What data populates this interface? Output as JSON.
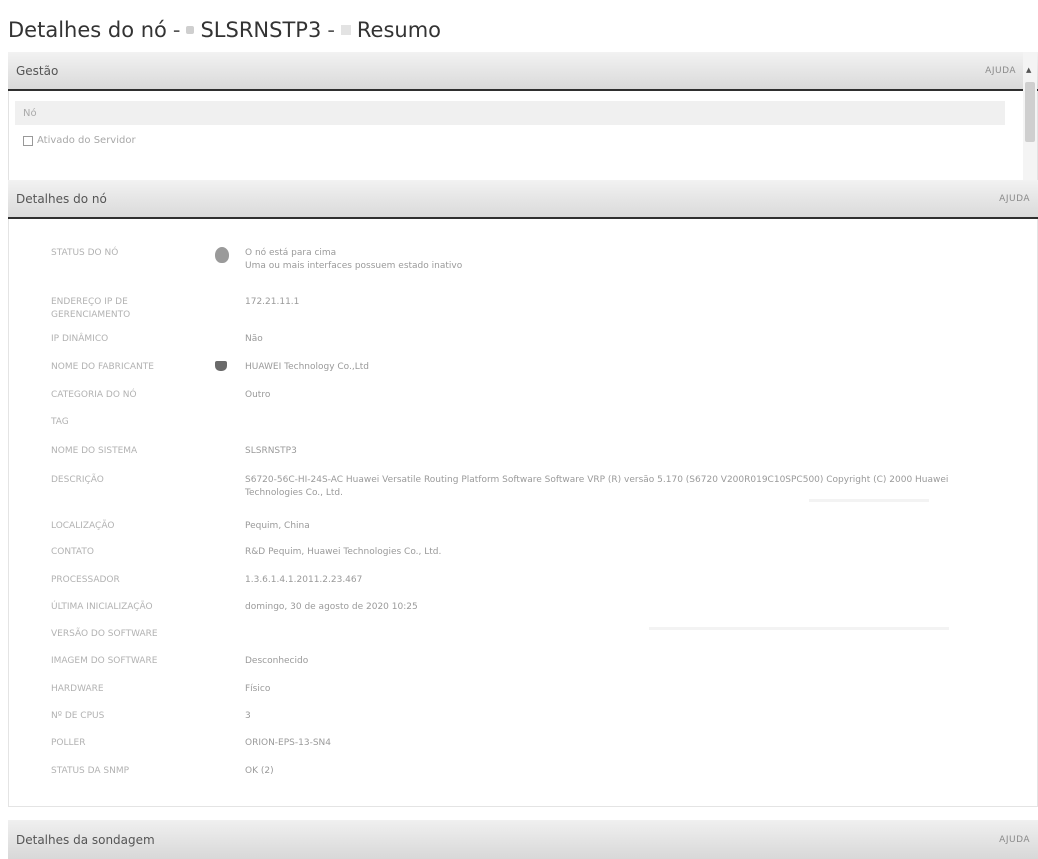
{
  "title": {
    "part1": "Detalhes do nó",
    "sep": "-",
    "part2": "SLSRNSTP3",
    "part3": "Resumo"
  },
  "gestao": {
    "header": "Gestão",
    "help": "AJUDA",
    "field_label": "Nó",
    "checkbox_label": "Ativado do Servidor"
  },
  "detalhes": {
    "header": "Detalhes do nó",
    "help": "AJUDA",
    "rows": [
      {
        "k": "STATUS DO NÓ",
        "v": "O nó está para cima\nUma ou mais interfaces possuem estado inativo",
        "icon": "status-icon"
      },
      {
        "k": "ENDEREÇO IP DE GERENCIAMENTO",
        "v": "172.21.11.1"
      },
      {
        "k": "IP DINÂMICO",
        "v": "Não"
      },
      {
        "k": "NOME DO FABRICANTE",
        "v": "HUAWEI Technology Co.,Ltd",
        "icon": "vendor-icon"
      },
      {
        "k": "CATEGORIA DO NÓ",
        "v": "Outro"
      },
      {
        "k": "TAG",
        "v": ""
      },
      {
        "k": "NOME DO SISTEMA",
        "v": "SLSRNSTP3"
      },
      {
        "k": "DESCRIÇÃO",
        "v": "S6720-56C-HI-24S-AC Huawei Versatile Routing Platform Software Software VRP (R) versão 5.170 (S6720 V200R019C10SPC500) Copyright (C) 2000 Huawei Technologies Co., Ltd."
      },
      {
        "k": "LOCALIZAÇÃO",
        "v": "Pequim, China"
      },
      {
        "k": "CONTATO",
        "v": "R&D Pequim, Huawei Technologies Co., Ltd."
      },
      {
        "k": "PROCESSADOR",
        "v": "1.3.6.1.4.1.2011.2.23.467"
      },
      {
        "k": "ÚLTIMA INICIALIZAÇÃO",
        "v": "domingo, 30 de agosto de 2020 10:25"
      },
      {
        "k": "VERSÃO DO SOFTWARE",
        "v": ""
      },
      {
        "k": "IMAGEM DO SOFTWARE",
        "v": "Desconhecido"
      },
      {
        "k": "HARDWARE",
        "v": "Físico"
      },
      {
        "k": "Nº DE CPUS",
        "v": "3"
      },
      {
        "k": "POLLER",
        "v": "ORION-EPS-13-SN4"
      },
      {
        "k": "STATUS DA SNMP",
        "v": "OK (2)"
      }
    ]
  },
  "sondagem": {
    "header": "Detalhes da sondagem",
    "help": "AJUDA"
  }
}
